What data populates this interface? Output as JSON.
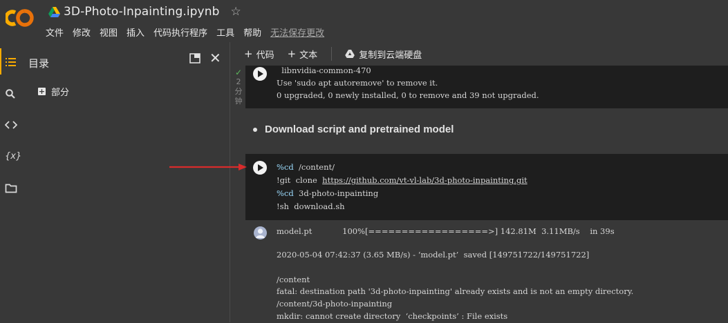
{
  "header": {
    "logo_text": "CO",
    "notebook_title": "3D-Photo-Inpainting.ipynb",
    "star_icon": "☆",
    "menu": [
      "文件",
      "修改",
      "视图",
      "插入",
      "代码执行程序",
      "工具",
      "帮助"
    ],
    "unsaved_notice": "无法保存更改"
  },
  "sidebar": {
    "title": "目录",
    "item_label": "部分"
  },
  "toolbar": {
    "add_code": "代码",
    "add_text": "文本",
    "copy_to_drive": "复制到云端硬盘"
  },
  "cells": {
    "prev_output": {
      "exec_minutes": "2",
      "exec_unit": [
        "分",
        "钟"
      ],
      "lines": [
        "  libnvidia-common-470",
        "Use 'sudo apt autoremove' to remove it.",
        "0 upgraded, 0 newly installed, 0 to remove and 39 not upgraded."
      ]
    },
    "text_bullet": "Download script and pretrained model",
    "code": {
      "line1_magic": "%cd",
      "line1_arg": "  /content/",
      "line2_cmd": "!git  clone  ",
      "line2_link": "https://github.com/vt-vl-lab/3d-photo-inpainting.git",
      "line3_magic": "%cd",
      "line3_arg": "  3d-photo-inpainting",
      "line4": "!sh  download.sh"
    },
    "output": {
      "line1": "model.pt            100%[==================>] 142.81M  3.11MB/s    in 39s",
      "line2": "2020-05-04 07:42:37 (3.65 MB/s) - ‘model.pt’  saved [149751722/149751722]",
      "line3": "/content",
      "line4": "fatal: destination path '3d-photo-inpainting' already exists and is not an empty directory.",
      "line5": "/content/3d-photo-inpainting",
      "line6": "mkdir: cannot create directory  ‘checkpoints’ : File exists"
    }
  },
  "colors": {
    "logo_orange": "#f9ab00",
    "logo_dark_orange": "#e8710a",
    "arrow_red": "#d92b2b",
    "code_bg": "#1e1e1e",
    "page_bg": "#383838"
  }
}
